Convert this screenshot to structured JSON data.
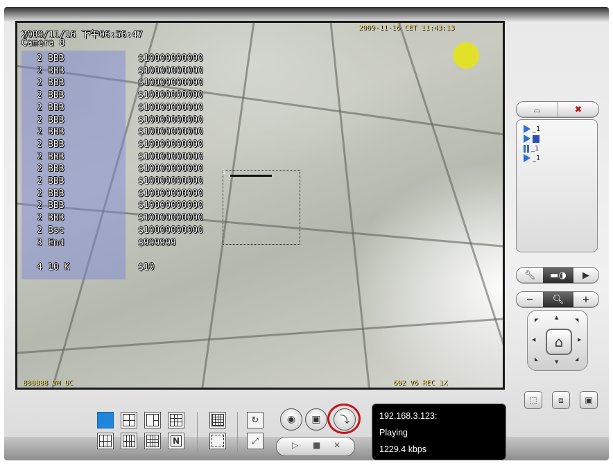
{
  "video": {
    "timestamp": "2009/11/16 下午06:56:47",
    "camera_label": "Camera 8",
    "camera_clock": "2009-11-16 CET 11:43:13",
    "bottom_left_osd": "888888 VM UC",
    "bottom_right_osd": "602 V6 REC 1X",
    "pos_rows": [
      {
        "qty": "2",
        "name": "BBB",
        "price": "$10000000000"
      },
      {
        "qty": "2",
        "name": "BBB",
        "price": "$10000000000"
      },
      {
        "qty": "2",
        "name": "BBB",
        "price": "$10000000000"
      },
      {
        "qty": "2",
        "name": "BBB",
        "price": "$10000000000"
      },
      {
        "qty": "2",
        "name": "BBB",
        "price": "$10000000000"
      },
      {
        "qty": "2",
        "name": "BBB",
        "price": "$10000000000"
      },
      {
        "qty": "2",
        "name": "BBB",
        "price": "$10000000000"
      },
      {
        "qty": "2",
        "name": "BBB",
        "price": "$10000000000"
      },
      {
        "qty": "2",
        "name": "BBB",
        "price": "$10000000000"
      },
      {
        "qty": "2",
        "name": "BBB",
        "price": "$10000000000"
      },
      {
        "qty": "2",
        "name": "BBB",
        "price": "$10000000000"
      },
      {
        "qty": "2",
        "name": "BBB",
        "price": "$10000000000"
      },
      {
        "qty": "2",
        "name": "BBB",
        "price": "$10000000000"
      },
      {
        "qty": "2",
        "name": "BBB",
        "price": "$10000000000"
      },
      {
        "qty": "2",
        "name": "Bsc",
        "price": "$10000000000"
      },
      {
        "qty": "3",
        "name": "End",
        "price": "$999999"
      }
    ],
    "pos_total": {
      "qty": "4",
      "name": "10 K",
      "price": "$10"
    },
    "selection_label": "1"
  },
  "playlist": {
    "items": [
      {
        "icon": "play-icon",
        "label": "_1"
      },
      {
        "icon": "play-icon",
        "label": ""
      },
      {
        "icon": "pause-icon",
        "label": "_1"
      },
      {
        "icon": "play-icon",
        "label": "_1"
      }
    ]
  },
  "status": {
    "ip": "192.168.3.123:",
    "state": "Playing",
    "bitrate": "1229.4 kbps"
  },
  "colors": {
    "accent": "#1f86dc",
    "highlight_ring": "#c4161c",
    "status_bg": "#000000"
  }
}
